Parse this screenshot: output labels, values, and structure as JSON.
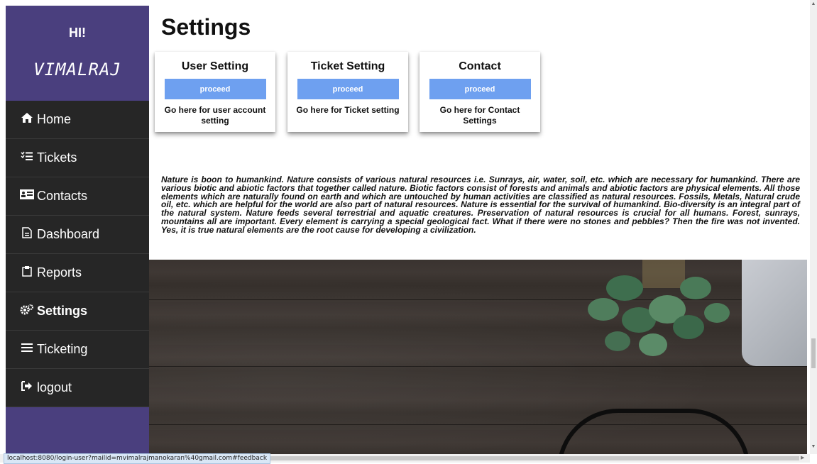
{
  "sidebar": {
    "greeting": "HI!",
    "username": "VIMALRAJ",
    "items": [
      {
        "icon": "home-icon",
        "glyph": "🏠︎",
        "label": "Home"
      },
      {
        "icon": "tickets-icon",
        "glyph": "☷",
        "label": "Tickets"
      },
      {
        "icon": "contacts-icon",
        "glyph": "▤",
        "label": "Contacts"
      },
      {
        "icon": "dashboard-icon",
        "glyph": "▭",
        "label": "Dashboard"
      },
      {
        "icon": "reports-icon",
        "glyph": "▢",
        "label": "Reports"
      },
      {
        "icon": "settings-icon",
        "glyph": "⚙",
        "label": "Settings"
      },
      {
        "icon": "ticketing-icon",
        "glyph": "≡",
        "label": "Ticketing"
      },
      {
        "icon": "logout-icon",
        "glyph": "➜",
        "label": "logout"
      }
    ]
  },
  "main": {
    "title": "Settings",
    "cards": [
      {
        "title": "User Setting",
        "button": "proceed",
        "desc": "Go here for user account setting"
      },
      {
        "title": "Ticket Setting",
        "button": "proceed",
        "desc": "Go here for Ticket setting"
      },
      {
        "title": "Contact",
        "button": "proceed",
        "desc": "Go here for Contact Settings"
      }
    ],
    "nature_text": "Nature is boon to humankind. Nature consists of various natural resources i.e. Sunrays, air, water, soil, etc. which are necessary for humankind. There are various biotic and abiotic factors that together called nature. Biotic factors consist of forests and animals and abiotic factors are physical elements. All those elements which are naturally found on earth and which are untouched by human activities are classified as natural resources. Fossils, Metals, Natural crude oil, etc. which are helpful for the world are also part of natural resources. Nature is essential for the survival of humankind. Bio-diversity is an integral part of the natural system. Nature feeds several terrestrial and aquatic creatures. Preservation of natural resources is crucial for all humans. Forest, sunrays, mountains all are important. Every element is carrying a special geological fact. What if there were no stones and pebbles? Then the fire was not invented. Yes, it is true natural elements are the root cause for developing a civilization."
  },
  "status_bar": {
    "url": "localhost:8080/login-user?mailid=mvimalrajmanokaran%40gmail.com#feedback"
  },
  "colors": {
    "sidebar_bg": "#4a3f7e",
    "nav_bg": "#262626",
    "button_bg": "#6ea0f0"
  }
}
